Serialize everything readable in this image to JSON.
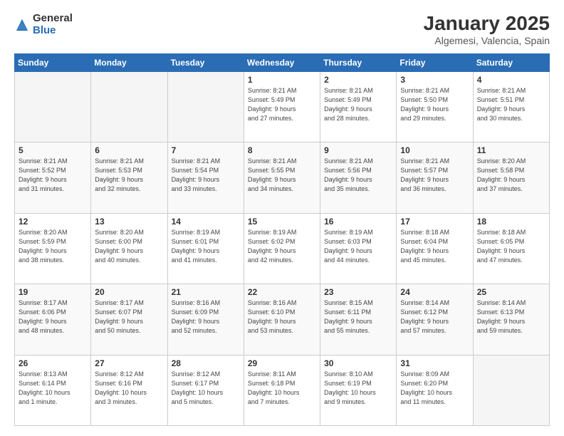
{
  "header": {
    "logo_general": "General",
    "logo_blue": "Blue",
    "title": "January 2025",
    "subtitle": "Algemesi, Valencia, Spain"
  },
  "weekdays": [
    "Sunday",
    "Monday",
    "Tuesday",
    "Wednesday",
    "Thursday",
    "Friday",
    "Saturday"
  ],
  "weeks": [
    [
      {
        "day": "",
        "info": ""
      },
      {
        "day": "",
        "info": ""
      },
      {
        "day": "",
        "info": ""
      },
      {
        "day": "1",
        "info": "Sunrise: 8:21 AM\nSunset: 5:49 PM\nDaylight: 9 hours\nand 27 minutes."
      },
      {
        "day": "2",
        "info": "Sunrise: 8:21 AM\nSunset: 5:49 PM\nDaylight: 9 hours\nand 28 minutes."
      },
      {
        "day": "3",
        "info": "Sunrise: 8:21 AM\nSunset: 5:50 PM\nDaylight: 9 hours\nand 29 minutes."
      },
      {
        "day": "4",
        "info": "Sunrise: 8:21 AM\nSunset: 5:51 PM\nDaylight: 9 hours\nand 30 minutes."
      }
    ],
    [
      {
        "day": "5",
        "info": "Sunrise: 8:21 AM\nSunset: 5:52 PM\nDaylight: 9 hours\nand 31 minutes."
      },
      {
        "day": "6",
        "info": "Sunrise: 8:21 AM\nSunset: 5:53 PM\nDaylight: 9 hours\nand 32 minutes."
      },
      {
        "day": "7",
        "info": "Sunrise: 8:21 AM\nSunset: 5:54 PM\nDaylight: 9 hours\nand 33 minutes."
      },
      {
        "day": "8",
        "info": "Sunrise: 8:21 AM\nSunset: 5:55 PM\nDaylight: 9 hours\nand 34 minutes."
      },
      {
        "day": "9",
        "info": "Sunrise: 8:21 AM\nSunset: 5:56 PM\nDaylight: 9 hours\nand 35 minutes."
      },
      {
        "day": "10",
        "info": "Sunrise: 8:21 AM\nSunset: 5:57 PM\nDaylight: 9 hours\nand 36 minutes."
      },
      {
        "day": "11",
        "info": "Sunrise: 8:20 AM\nSunset: 5:58 PM\nDaylight: 9 hours\nand 37 minutes."
      }
    ],
    [
      {
        "day": "12",
        "info": "Sunrise: 8:20 AM\nSunset: 5:59 PM\nDaylight: 9 hours\nand 38 minutes."
      },
      {
        "day": "13",
        "info": "Sunrise: 8:20 AM\nSunset: 6:00 PM\nDaylight: 9 hours\nand 40 minutes."
      },
      {
        "day": "14",
        "info": "Sunrise: 8:19 AM\nSunset: 6:01 PM\nDaylight: 9 hours\nand 41 minutes."
      },
      {
        "day": "15",
        "info": "Sunrise: 8:19 AM\nSunset: 6:02 PM\nDaylight: 9 hours\nand 42 minutes."
      },
      {
        "day": "16",
        "info": "Sunrise: 8:19 AM\nSunset: 6:03 PM\nDaylight: 9 hours\nand 44 minutes."
      },
      {
        "day": "17",
        "info": "Sunrise: 8:18 AM\nSunset: 6:04 PM\nDaylight: 9 hours\nand 45 minutes."
      },
      {
        "day": "18",
        "info": "Sunrise: 8:18 AM\nSunset: 6:05 PM\nDaylight: 9 hours\nand 47 minutes."
      }
    ],
    [
      {
        "day": "19",
        "info": "Sunrise: 8:17 AM\nSunset: 6:06 PM\nDaylight: 9 hours\nand 48 minutes."
      },
      {
        "day": "20",
        "info": "Sunrise: 8:17 AM\nSunset: 6:07 PM\nDaylight: 9 hours\nand 50 minutes."
      },
      {
        "day": "21",
        "info": "Sunrise: 8:16 AM\nSunset: 6:09 PM\nDaylight: 9 hours\nand 52 minutes."
      },
      {
        "day": "22",
        "info": "Sunrise: 8:16 AM\nSunset: 6:10 PM\nDaylight: 9 hours\nand 53 minutes."
      },
      {
        "day": "23",
        "info": "Sunrise: 8:15 AM\nSunset: 6:11 PM\nDaylight: 9 hours\nand 55 minutes."
      },
      {
        "day": "24",
        "info": "Sunrise: 8:14 AM\nSunset: 6:12 PM\nDaylight: 9 hours\nand 57 minutes."
      },
      {
        "day": "25",
        "info": "Sunrise: 8:14 AM\nSunset: 6:13 PM\nDaylight: 9 hours\nand 59 minutes."
      }
    ],
    [
      {
        "day": "26",
        "info": "Sunrise: 8:13 AM\nSunset: 6:14 PM\nDaylight: 10 hours\nand 1 minute."
      },
      {
        "day": "27",
        "info": "Sunrise: 8:12 AM\nSunset: 6:16 PM\nDaylight: 10 hours\nand 3 minutes."
      },
      {
        "day": "28",
        "info": "Sunrise: 8:12 AM\nSunset: 6:17 PM\nDaylight: 10 hours\nand 5 minutes."
      },
      {
        "day": "29",
        "info": "Sunrise: 8:11 AM\nSunset: 6:18 PM\nDaylight: 10 hours\nand 7 minutes."
      },
      {
        "day": "30",
        "info": "Sunrise: 8:10 AM\nSunset: 6:19 PM\nDaylight: 10 hours\nand 9 minutes."
      },
      {
        "day": "31",
        "info": "Sunrise: 8:09 AM\nSunset: 6:20 PM\nDaylight: 10 hours\nand 11 minutes."
      },
      {
        "day": "",
        "info": ""
      }
    ]
  ]
}
